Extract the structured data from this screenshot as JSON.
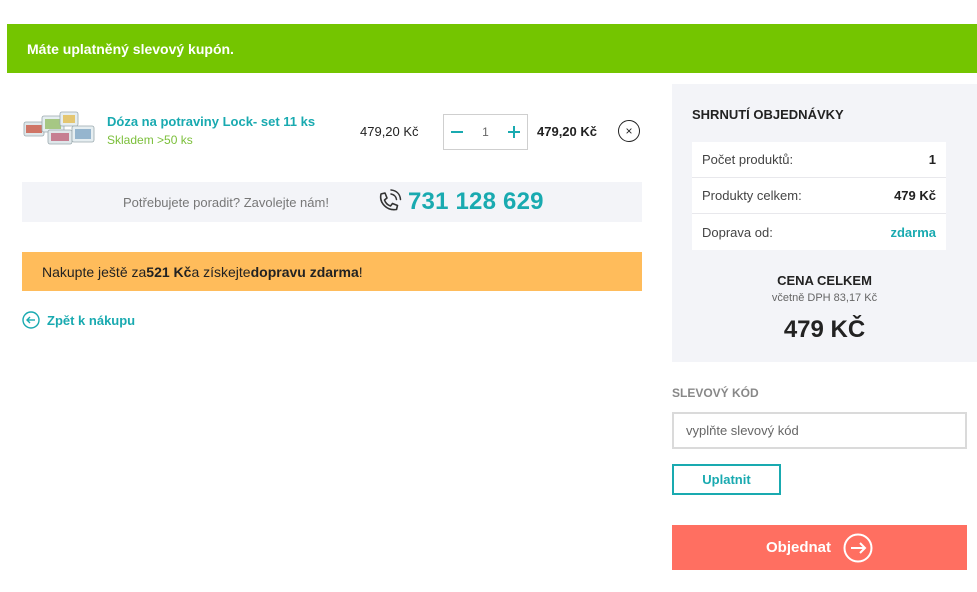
{
  "banner": {
    "text": "Máte uplatněný slevový kupón."
  },
  "cart": {
    "item": {
      "name": "Dóza na potraviny Lock- set 11 ks",
      "stock": "Skladem >50 ks",
      "unit_price": "479,20 Kč",
      "quantity": "1",
      "total": "479,20 Kč",
      "remove_symbol": "×"
    }
  },
  "help": {
    "text": "Potřebujete poradit? Zavolejte nám!",
    "phone": "731 128 629"
  },
  "promo": {
    "prefix": "Nakupte ještě za ",
    "amount": "521 Kč",
    "middle": " a získejte ",
    "highlight": "dopravu zdarma",
    "suffix": "!"
  },
  "back_link": {
    "label": "Zpět k nákupu"
  },
  "summary": {
    "title": "SHRNUTÍ OBJEDNÁVKY",
    "rows": [
      {
        "label": "Počet produktů:",
        "value": "1"
      },
      {
        "label": "Produkty celkem:",
        "value": "479 Kč"
      },
      {
        "label": "Doprava od:",
        "value": "zdarma"
      }
    ],
    "total_label": "CENA CELKEM",
    "total_vat": "včetně DPH 83,17 Kč",
    "total_value": "479 KČ"
  },
  "coupon": {
    "label": "SLEVOVÝ KÓD",
    "placeholder": "vyplňte slevový kód",
    "apply_label": "Uplatnit"
  },
  "order": {
    "label": "Objednat"
  },
  "colors": {
    "accent": "#19aab0",
    "success_banner": "#74c500",
    "promo": "#ffbc5b",
    "order_button": "#ff6f61"
  }
}
